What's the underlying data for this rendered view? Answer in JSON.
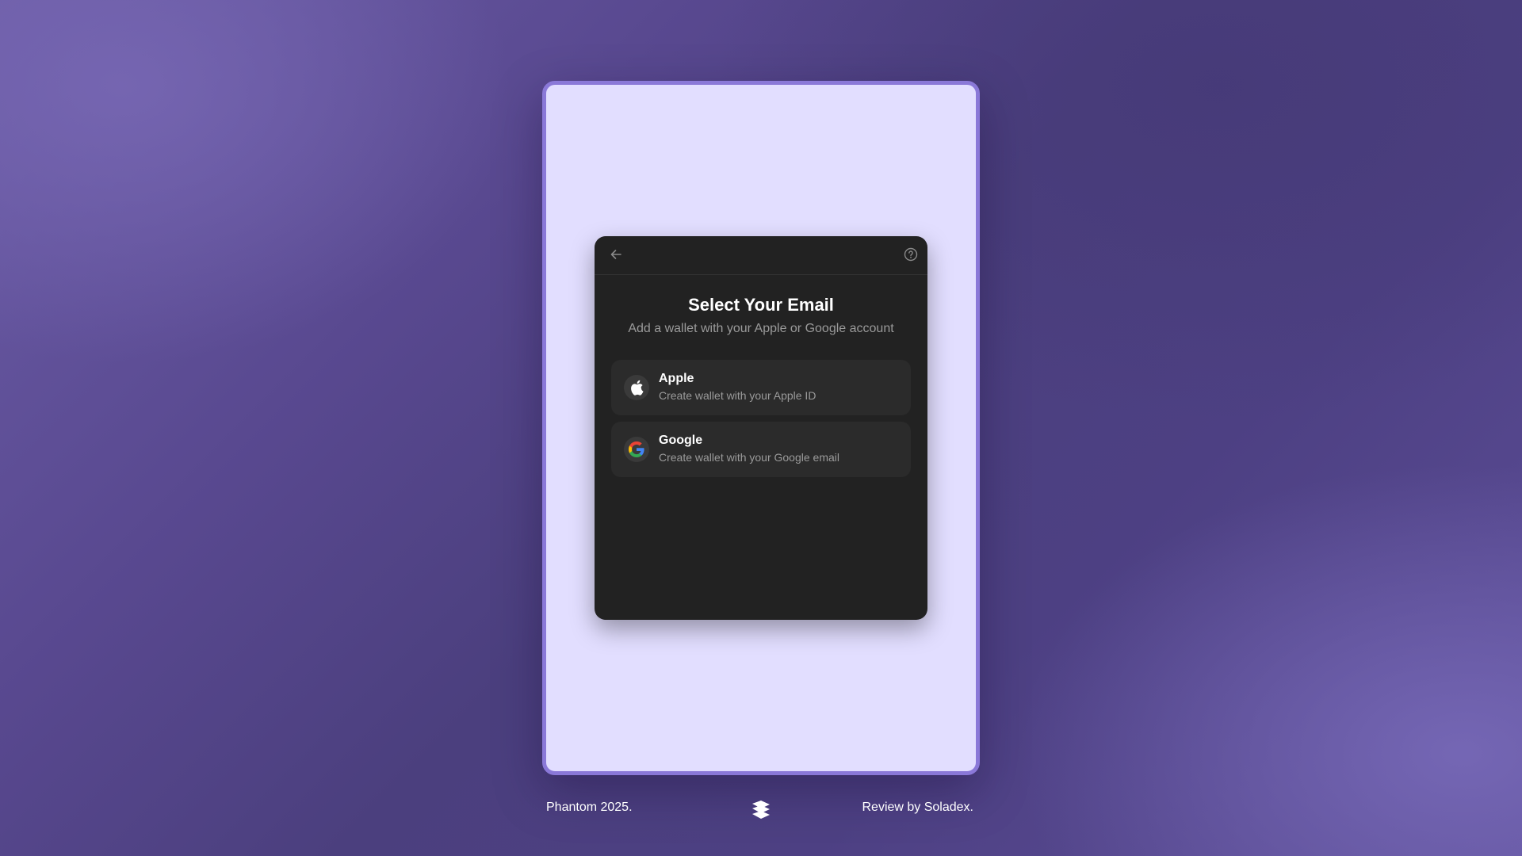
{
  "modal": {
    "title": "Select Your Email",
    "subtitle": "Add a wallet with your Apple or Google account",
    "back_icon": "arrow-left-icon",
    "help_icon": "question-circle-icon",
    "options": [
      {
        "title": "Apple",
        "description": "Create wallet with your Apple ID",
        "icon": "apple-icon"
      },
      {
        "title": "Google",
        "description": "Create wallet with your Google email",
        "icon": "google-icon"
      }
    ]
  },
  "footer": {
    "left_text": "Phantom 2025.",
    "right_text": "Review by Soladex.",
    "logo_icon": "soladex-logo-icon"
  },
  "colors": {
    "background": "#4b3f7e",
    "device_frame": "#8a78d8",
    "device_screen": "#e2deff",
    "modal_bg": "#222222",
    "option_bg": "#2b2b2b",
    "text_primary": "#ffffff",
    "text_secondary": "#9a9a9a"
  }
}
